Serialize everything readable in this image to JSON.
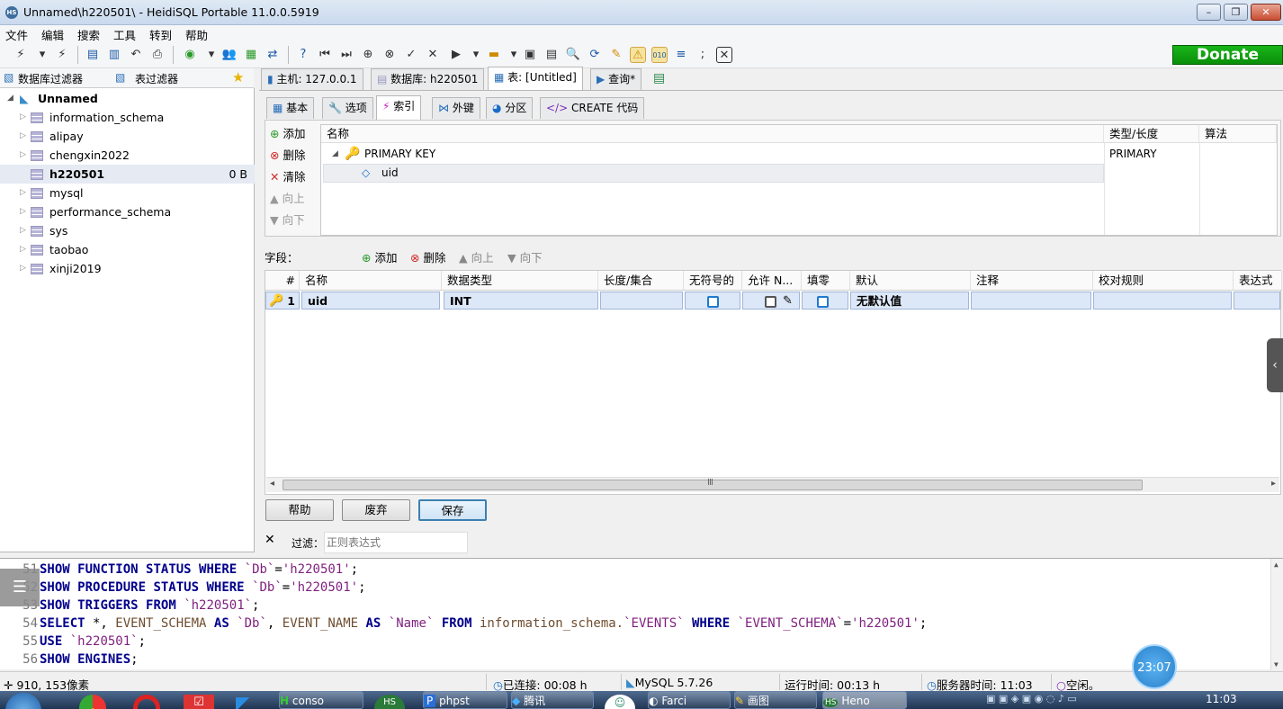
{
  "window": {
    "title": "Unnamed\\h220501\\ - HeidiSQL Portable 11.0.0.5919",
    "app_icon": "HS"
  },
  "menu": [
    "文件",
    "编辑",
    "搜索",
    "工具",
    "转到",
    "帮助"
  ],
  "donate_label": "Donate",
  "left_panel": {
    "db_filter": "数据库过滤器",
    "table_filter": "表过滤器",
    "session": "Unnamed",
    "databases": [
      {
        "name": "information_schema",
        "size": ""
      },
      {
        "name": "alipay",
        "size": ""
      },
      {
        "name": "chengxin2022",
        "size": ""
      },
      {
        "name": "h220501",
        "size": "0 B"
      },
      {
        "name": "mysql",
        "size": ""
      },
      {
        "name": "performance_schema",
        "size": ""
      },
      {
        "name": "sys",
        "size": ""
      },
      {
        "name": "taobao",
        "size": ""
      },
      {
        "name": "xinji2019",
        "size": ""
      }
    ]
  },
  "main_tabs": [
    "主机: 127.0.0.1",
    "数据库: h220501",
    "表: [Untitled]",
    "查询*"
  ],
  "sub_tabs": [
    "基本",
    "选项",
    "索引",
    "外键",
    "分区",
    "CREATE 代码"
  ],
  "index": {
    "buttons": [
      "添加",
      "删除",
      "清除",
      "向上",
      "向下"
    ],
    "headers": [
      "名称",
      "类型/长度",
      "算法"
    ],
    "key_name": "PRIMARY KEY",
    "key_type": "PRIMARY",
    "column": "uid"
  },
  "fields": {
    "label": "字段：",
    "buttons": [
      "添加",
      "删除",
      "向上",
      "向下"
    ],
    "headers": [
      "#",
      "名称",
      "数据类型",
      "长度/集合",
      "无符号的",
      "允许 N...",
      "填零",
      "默认",
      "注释",
      "校对规则",
      "表达式"
    ],
    "rows": [
      {
        "num": "1",
        "name": "uid",
        "type": "INT",
        "length": "",
        "default": "无默认值"
      }
    ]
  },
  "bottom_buttons": [
    "帮助",
    "废弃",
    "保存"
  ],
  "filter": {
    "label": "过滤：",
    "placeholder": "正则表达式"
  },
  "sql_log": [
    {
      "n": "51",
      "text": "SHOW FUNCTION STATUS WHERE `Db`='h220501';"
    },
    {
      "n": "52",
      "text": "SHOW PROCEDURE STATUS WHERE `Db`='h220501';"
    },
    {
      "n": "53",
      "text": "SHOW TRIGGERS FROM `h220501`;"
    },
    {
      "n": "54",
      "text": "SELECT *, EVENT_SCHEMA AS `Db`, EVENT_NAME AS `Name` FROM information_schema.`EVENTS` WHERE `EVENT_SCHEMA`='h220501';"
    },
    {
      "n": "55",
      "text": "USE `h220501`;"
    },
    {
      "n": "56",
      "text": "SHOW ENGINES;"
    }
  ],
  "status": {
    "cursor": "910, 153像素",
    "connected": "已连接: 00:08 h",
    "server": "MySQL 5.7.26",
    "uptime": "运行时间: 00:13 h",
    "server_time": "服务器时间: 11:03",
    "idle": "空闲。"
  },
  "clock_badge": "23:07",
  "taskbar": {
    "items": [
      "conso",
      "phpst",
      "腾讯",
      "Farci",
      "画图",
      "Heno"
    ],
    "time": "11:03"
  }
}
